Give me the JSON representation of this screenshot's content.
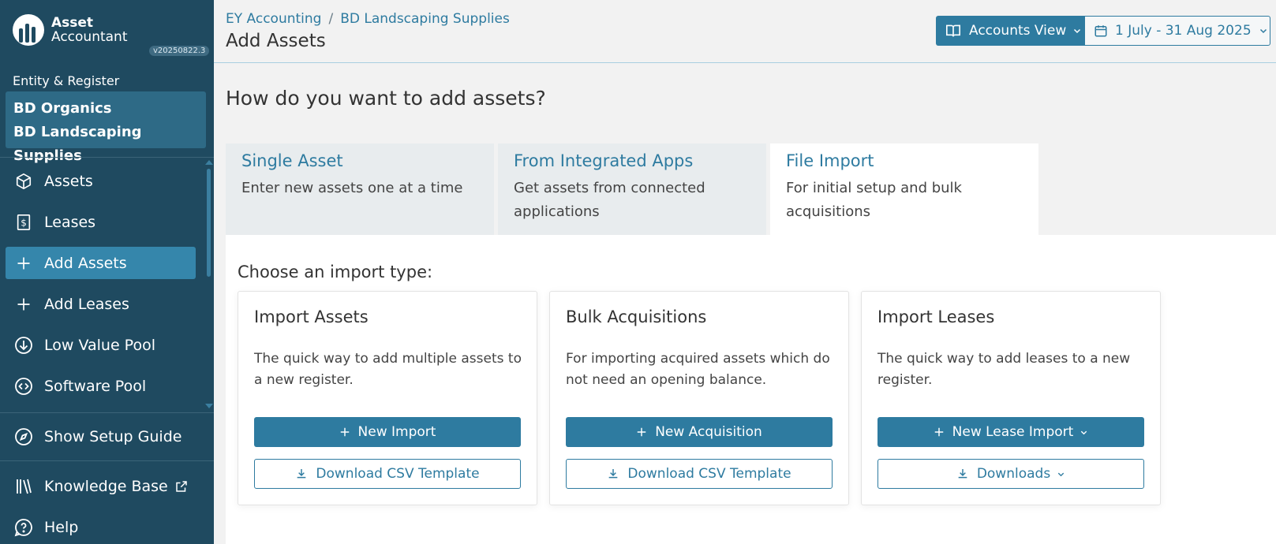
{
  "app": {
    "logo_line1": "Asset",
    "logo_line2": "Accountant",
    "version": "v20250822.3"
  },
  "sidebar": {
    "entity_label": "Entity & Register",
    "entity_name": "BD Organics",
    "register_name": "BD Landscaping Supplies",
    "items": [
      {
        "label": "Assets",
        "icon": "box-icon"
      },
      {
        "label": "Leases",
        "icon": "lease-dollar-icon"
      },
      {
        "label": "Add Assets",
        "icon": "plus-icon",
        "active": true
      },
      {
        "label": "Add Leases",
        "icon": "plus-icon"
      },
      {
        "label": "Low Value Pool",
        "icon": "arrow-down-circle-icon"
      },
      {
        "label": "Software Pool",
        "icon": "code-circle-icon"
      }
    ],
    "setup_guide": "Show Setup Guide",
    "knowledge_base": "Knowledge Base",
    "help": "Help"
  },
  "header": {
    "breadcrumb": [
      "EY Accounting",
      "BD Landscaping Supplies"
    ],
    "title": "Add Assets",
    "accounts_view": "Accounts View",
    "date_range": "1 July - 31 Aug 2025"
  },
  "main": {
    "question": "How do you want to add assets?",
    "tabs": [
      {
        "title": "Single Asset",
        "desc": "Enter new assets one at a time"
      },
      {
        "title": "From Integrated Apps",
        "desc": "Get assets from connected applications"
      },
      {
        "title": "File Import",
        "desc": "For initial setup and bulk acquisitions",
        "active": true
      }
    ],
    "choose_label": "Choose an import type:",
    "cards": [
      {
        "title": "Import Assets",
        "desc": "The quick way to add multiple assets to a new register.",
        "primary": "New Import",
        "secondary": "Download CSV Template"
      },
      {
        "title": "Bulk Acquisitions",
        "desc": "For importing acquired assets which do not need an opening balance.",
        "primary": "New Acquisition",
        "secondary": "Download CSV Template"
      },
      {
        "title": "Import Leases",
        "desc": "The quick way to add leases to a new register.",
        "primary": "New Lease Import",
        "secondary": "Downloads"
      }
    ]
  },
  "colors": {
    "sidebar_bg": "#1f4a60",
    "accent": "#2e7ba0",
    "active_nav": "#3586ab"
  }
}
